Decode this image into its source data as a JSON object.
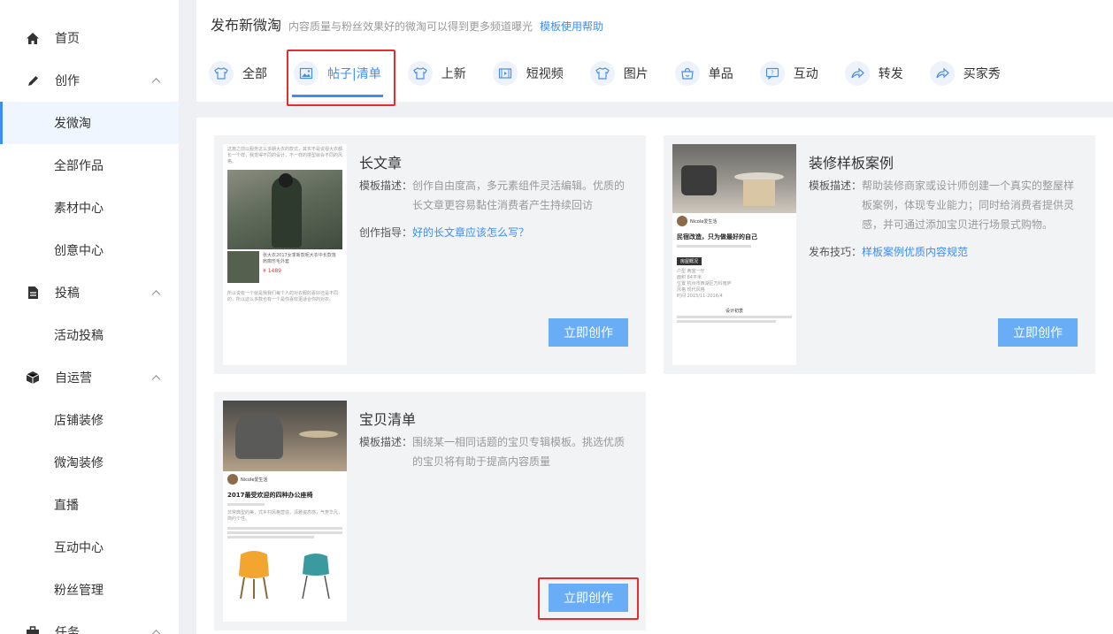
{
  "sidebar": {
    "home": "首页",
    "create": "创作",
    "create_items": [
      "发微淘",
      "全部作品",
      "素材中心",
      "创意中心"
    ],
    "submit": "投稿",
    "submit_items": [
      "活动投稿"
    ],
    "selfop": "自运营",
    "selfop_items": [
      "店铺装修",
      "微淘装修",
      "直播",
      "互动中心",
      "粉丝管理"
    ],
    "task": "任务"
  },
  "header": {
    "title": "发布新微淘",
    "subtitle": "内容质量与粉丝效果好的微淘可以得到更多频道曝光",
    "help_link": "模板使用帮助"
  },
  "tabs": [
    "全部",
    "帖子|清单",
    "上新",
    "短视频",
    "图片",
    "单品",
    "互动",
    "转发",
    "买家秀"
  ],
  "cards": [
    {
      "title": "长文章",
      "desc_label": "模板描述：",
      "desc": "创作自由度高，多元素组件灵活编辑。优质的长文章更容易黏住消费者产生持续回访",
      "guide_label": "创作指导：",
      "guide_link": "好的长文章应该怎么写？",
      "button": "立即创作"
    },
    {
      "title": "装修样板案例",
      "desc_label": "模板描述：",
      "desc": "帮助装修商家或设计师创建一个真实的整屋样板案例，体现专业能力；同时给消费者提供灵感，并可通过添加宝贝进行场景式购物。",
      "guide_label": "发布技巧：",
      "guide_link": "样板案例优质内容规范",
      "button": "立即创作"
    },
    {
      "title": "宝贝清单",
      "desc_label": "模板描述：",
      "desc": "围绕某一相同话题的宝贝专辑模板。挑选优质的宝贝将有助于提高内容质量",
      "button": "立即创作"
    }
  ],
  "thumbs": {
    "t1_text": "这篇之前以服务这么多期大衣的款式，其实不是说视大衣都长一个样，我觉得不同的设计，不一样的搭型就会不同的风格。",
    "t1_item": "张大衣2017女季新款呢大衣中长款落肩廓形毛外套",
    "t1_price": "¥ 1489",
    "t1_foot": "所以说有一个就是我我们每个人的对衣服的喜好还是不同的，所以这么多款也有一个是你喜欢更适合你的对衣。",
    "t2_user": "Nicole爱生活",
    "t2_title": "民宿改造，只为做最好的自己",
    "t2_tag": "房屋概况",
    "t2_rows": [
      "户型 两室一厅",
      "面积 84平米",
      "位置 杭州市西湖区万科南庐",
      "风格 现代风格",
      "时间 2015/11-2016/4"
    ],
    "t2_sec": "设计初衷",
    "t3_user": "Nicole爱生活",
    "t3_title": "2017最受欢迎的四种办公座椅",
    "t3_text": "非常典型的美，式乡村风格营造，清雅姿态感，气势华凡，简约个性。"
  }
}
